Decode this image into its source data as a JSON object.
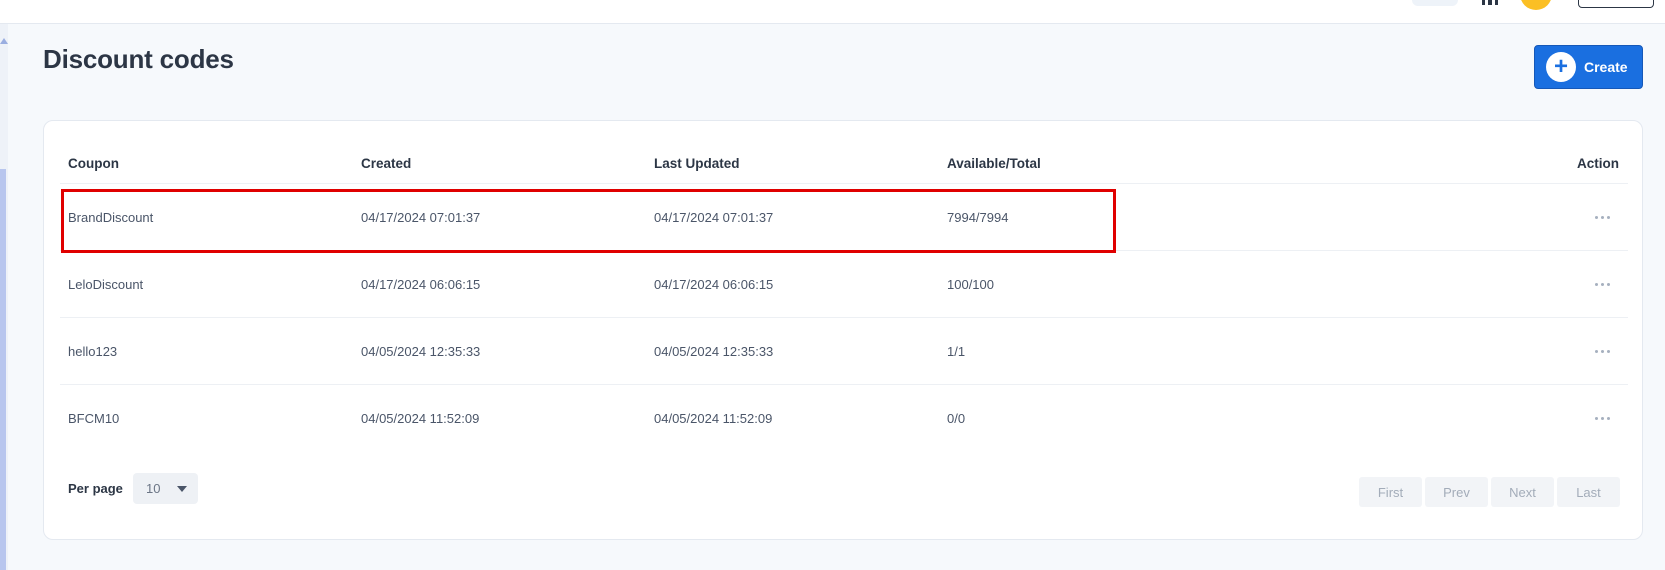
{
  "page": {
    "title": "Discount codes",
    "create_label": "Create"
  },
  "table": {
    "columns": [
      "Coupon",
      "Created",
      "Last Updated",
      "Available/Total",
      "Action"
    ],
    "rows": [
      {
        "coupon": "BrandDiscount",
        "created": "04/17/2024 07:01:37",
        "updated": "04/17/2024 07:01:37",
        "available": "7994/7994"
      },
      {
        "coupon": "LeloDiscount",
        "created": "04/17/2024 06:06:15",
        "updated": "04/17/2024 06:06:15",
        "available": "100/100"
      },
      {
        "coupon": "hello123",
        "created": "04/05/2024 12:35:33",
        "updated": "04/05/2024 12:35:33",
        "available": "1/1"
      },
      {
        "coupon": "BFCM10",
        "created": "04/05/2024 11:52:09",
        "updated": "04/05/2024 11:52:09",
        "available": "0/0"
      }
    ]
  },
  "pagination": {
    "per_page_label": "Per page",
    "per_page_value": "10",
    "buttons": [
      "First",
      "Prev",
      "Next",
      "Last"
    ]
  },
  "icons": {
    "create": "plus-icon",
    "row_action": "more-horizontal-icon",
    "select": "chevron-down-icon"
  },
  "colors": {
    "accent": "#1a6fe0",
    "highlight": "#e00000",
    "background": "#f6f9fc"
  }
}
